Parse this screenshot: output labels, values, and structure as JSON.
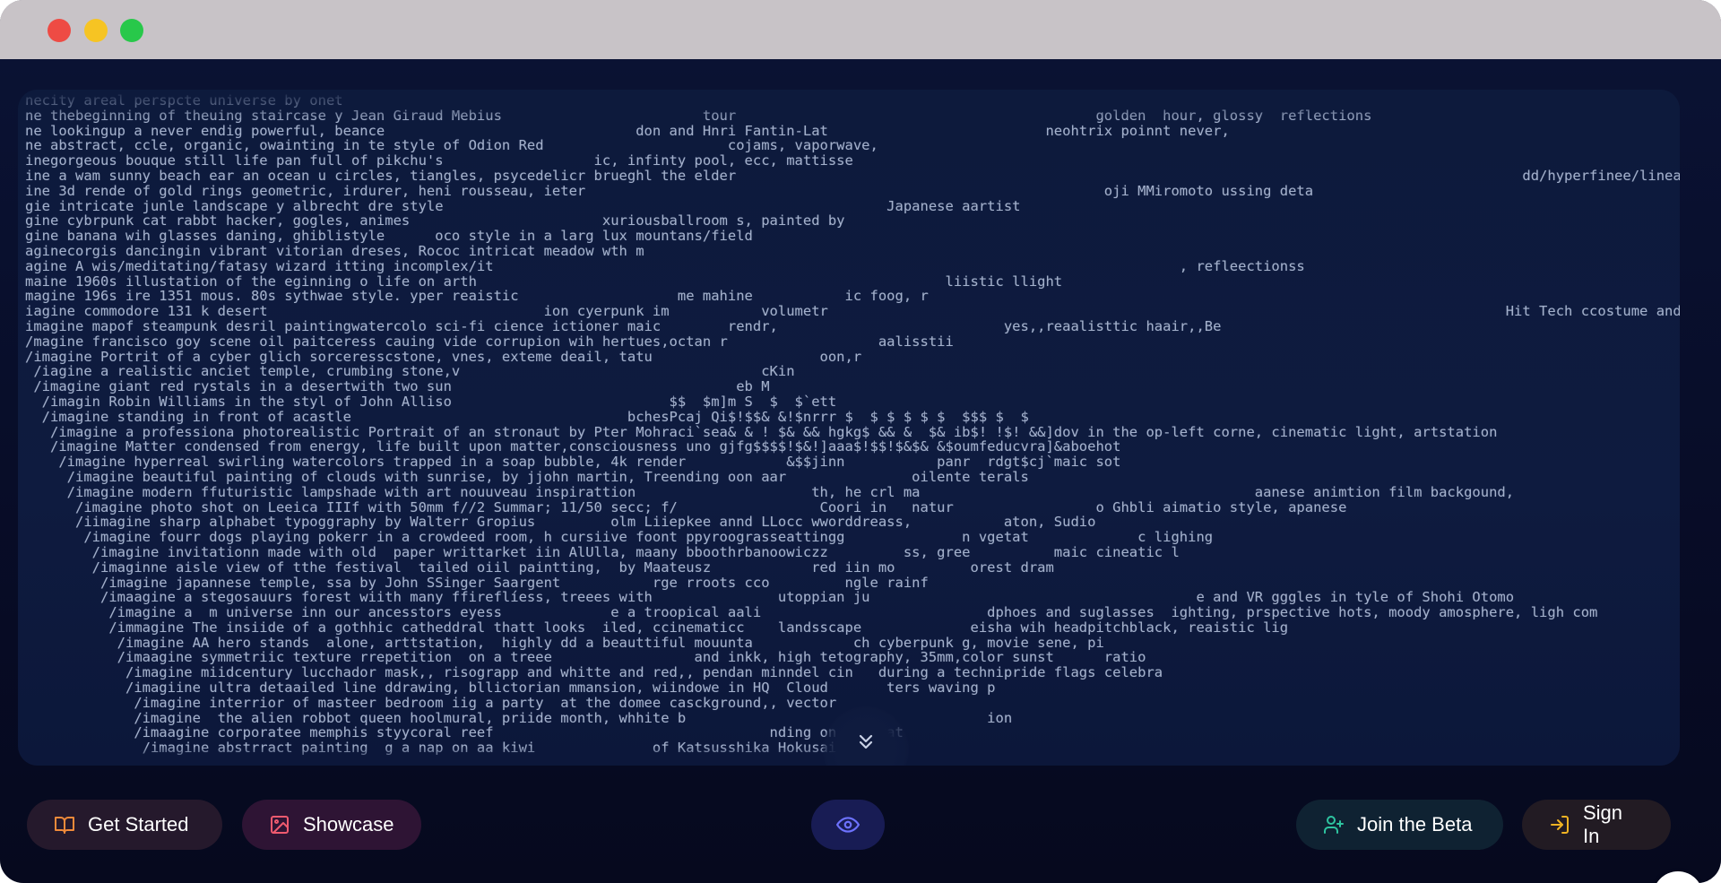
{
  "window": {
    "controls": [
      "close",
      "minimize",
      "maximize"
    ]
  },
  "prompt_panel": {
    "lines": [
      "necity areal perspcte universe by onet                                                                                                                                                                             d  light rays, pportals into",
      "ne thebeginning of theuing staircase y Jean Giraud Mebius                        tour                                           golden  hour, glossy  reflections",
      "ne lookingup a never endig powerful, beance                              don and Hnri Fantin-Lat                          neohtrix poinnt never,",
      "ne abstract, ccle, organic, owainting in te style of Odion Red                      cojams, vaporwave,",
      "inegorgeous bouque still life pan full of pikchu's                  ic, infinty pool, ecc, mattisse",
      "ine a wam sunny beach ear an ocean u circles, tiangles, psycedelicr brueghl the elder                                                                                              dd/hyperfinee/lineart/prrint black papper ink t",
      "ine 3d rende of gold rings geometric, irdurer, heni rousseau, ieter                                                              oji MMiromoto ussing deta",
      "gie intricate junle landscape y albrecht dre style                                                     Japanese aartist",
      "gine cybrpunk cat rabbt hacker, gogles, animes                       xuriousballroom s, painted by",
      "gine banana wih glasses daning, ghiblistyle      oco style in a larg lux mountans/field",
      "aginecorgis dancingin vibrant vitorian dreses, Rococ intricat meadow wth m",
      "agine A wis/meditating/fatasy wizard itting incomplex/it                                                                                  , refleectionss",
      "maine 1960s illustation of the eginning o life on arth                                                        liistic llight",
      "magine 196s ire 1351 mous. 80s sythwae style. yper reaistic                   me mahine           ic foog, r",
      "iagine commodore 131 k desert                                 ion cyerpunk im           volumetr                                                                                 Hit Tech ccostume and Helmmet details,Beautiful",
      "imagine mapof steampunk desril paintingwatercolo sci-fi cience ictioner maic        rendr,                           yes,,reaalisttic haair,,Be",
      "/magine francisco goy scene oil paitceress cauing vide corrupion wih hertues,octan r                  aalisstii",
      "/imagine Portrit of a cyber glich sorceresscstone, vnes, exteme deail, tatu                    oon,r",
      " /iagine a realistic anciet temple, crumbing stone,v                                    cKin",
      " /imagine giant red rystals in a desertwith two sun                                  eb M",
      "  /imagin Robin Williams in the styl of John Alliso                          $$  $m]m S  $  $`ett",
      "  /imagine standing in front of acastle                                 bchesPcaj Qi$!$$& &!$nrrr $  $ $ $ $ $  $$$ $  $",
      "   /imagine a professiona photorealistic Portrait of an stronaut by Pter Mohraci`sea& & ! $& && hgkg$ && &  $& ib$! !$! &&]dov in the op-left corne, cinematic light, artstation",
      "   /imagine Matter condensed from energy, life built upon matter,consciousness uno gjfg$$$$!$&!]aaa$!$$!$&$& &$oumfeducvra]&aboehot",
      "    /imagine hyperreal swirling watercolors trapped in a soap bubble, 4k render            &$$jinn           panr  rdgt$cj`maic sot",
      "     /imagine beautiful painting of clouds with sunrise, by jjohn martin, Treending oon aar               oilente terals",
      "     /imagine modern ffuturistic lampshade with art nouuveau inspirattion                     th, he crl ma                                        aanese animtion film backgound,",
      "      /imagine photo shot on Leeica IIIf with 50mm f//2 Summar; 11/50 secc; f/                 Coori in   natur                 o Ghbli aimatio style, apanese",
      "      /iimagine sharp alphabet typoggraphy by Walterr Gropius         olm Liiepkee annd LLocc wworddreass,           aton, Sudio",
      "       /imagine fourr dogs playing pokerr in a crowdeed room, h cursiive foont ppyroograsseattingg              n vgetat             c lighing",
      "        /imagine invitationn made with old  paper writtarket iin AlUlla, maany bboothrbanoowiczz         ss, gree          maic cineatic l",
      "        /imaginne aisle view of tthe festival  tailed oiil paintting,  by Maateusz            red iin mo         orest dram",
      "         /imagine japannese temple, ssa by John SSinger Saargent           rge rroots cco         ngle rainf",
      "         /imaagine a stegosauurs forest wiith many ffireflíess, treees with               utoppian ju                                       e and VR gggles in tyle of Shohi Otomo",
      "          /imagine a  m universe inn our ancesstors eyess             e a troopical aali                           dphoes and suglasses  ighting, prspective hots, moody amosphere, ligh com",
      "          /immagine The insiide of a gothhic catheddral thatt looks  iled, ccinematicc    landsscape             eisha wih headpitchblack, reaistic lig",
      "           /imagine AA hero stands  alone, arttstation,  highly dd a beauttiful mouunta            ch cyberpunk g, movie sene, pi",
      "           /imaagine symmetriic texture rrepetition  on a treee                 and inkk, high tetography, 35mm,color sunst      ratio",
      "            /imagine miidcentury lucchador mask,, risograpp and whitte and red,, pendan minndel cin   during a technipride flags celebra",
      "            /imagiine ultra detaailed line ddrawing, bllictorian mmansion, wiindowe in HQ  Cloud       ters waving p",
      "             /imagine interrior of masteer bedroom iig a party  at the domee casckground,, vector",
      "             /imagine  the alien robbot queen hoolmural, priide month, whhite b                                    ion",
      "             /imaagine corporatee memphis styycoral reef                                 nding on artstat",
      "              /imagine abstrract painting  g a nap on aa kiwi              of Katsusshika Hokusai,"
    ]
  },
  "toolbar": {
    "get_started_label": "Get Started",
    "get_started_icon": "book-open-icon",
    "showcase_label": "Showcase",
    "showcase_icon": "image-icon",
    "visibility_icon": "eye-icon",
    "join_beta_label": "Join the Beta",
    "join_beta_icon": "user-plus-icon",
    "sign_in_label": "Sign In",
    "sign_in_icon": "sign-in-icon"
  },
  "scroll_icon": "chevrons-down-icon",
  "assistant_icon": "openai-logo-icon",
  "colors": {
    "background": "#070b24",
    "panel": "#0e1b3f",
    "prompt_text": "#a3b0cb",
    "get_started_accent": "#f08a3a",
    "showcase_accent": "#ef5a6f",
    "eye_accent": "#6d72ff",
    "join_beta_accent": "#2ec4a0",
    "sign_in_accent": "#f0b323"
  }
}
